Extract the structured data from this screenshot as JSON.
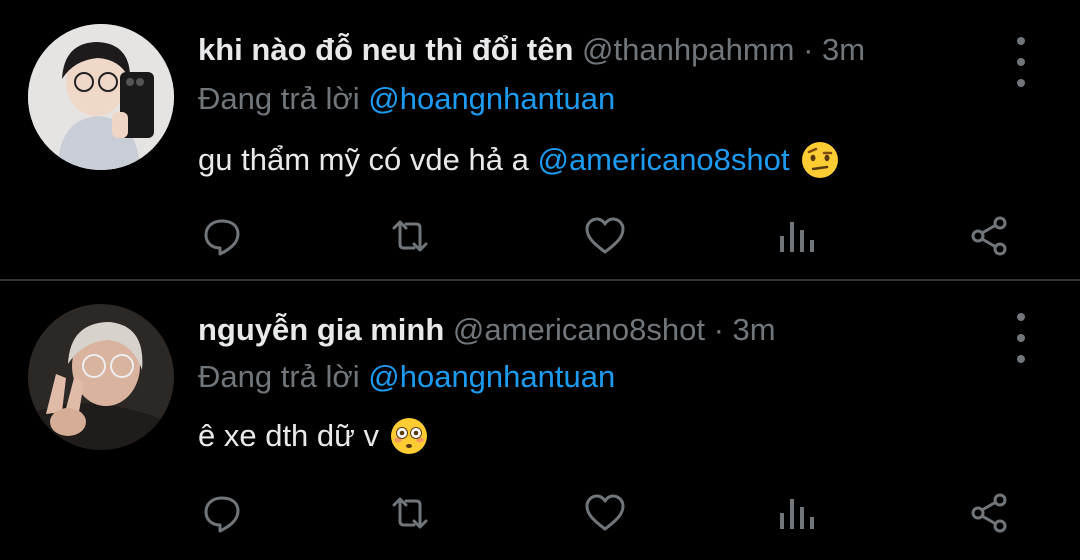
{
  "tweets": [
    {
      "name": "khi nào đỗ neu thì đổi tên",
      "handle": "@thanhpahmm",
      "dot": "·",
      "time": "3m",
      "reply_label": "Đang trả lời",
      "reply_mention": "@hoangnhantuan",
      "text": "gu thẩm mỹ có vde hả a",
      "text_mention": "@americano8shot",
      "emoji": "raised-eyebrow-emoji"
    },
    {
      "name": "nguyễn gia minh",
      "handle": "@americano8shot",
      "dot": "·",
      "time": "3m",
      "reply_label": "Đang trả lời",
      "reply_mention": "@hoangnhantuan",
      "text": "ê xe dth dữ v",
      "emoji": "flushed-face-emoji"
    }
  ],
  "actions": [
    "reply-icon",
    "retweet-icon",
    "like-icon",
    "analytics-icon",
    "share-icon"
  ],
  "colors": {
    "background": "#000000",
    "text": "#e7e9ea",
    "muted": "#71767b",
    "accent": "#1d9bf0",
    "divider": "#2f3336"
  }
}
